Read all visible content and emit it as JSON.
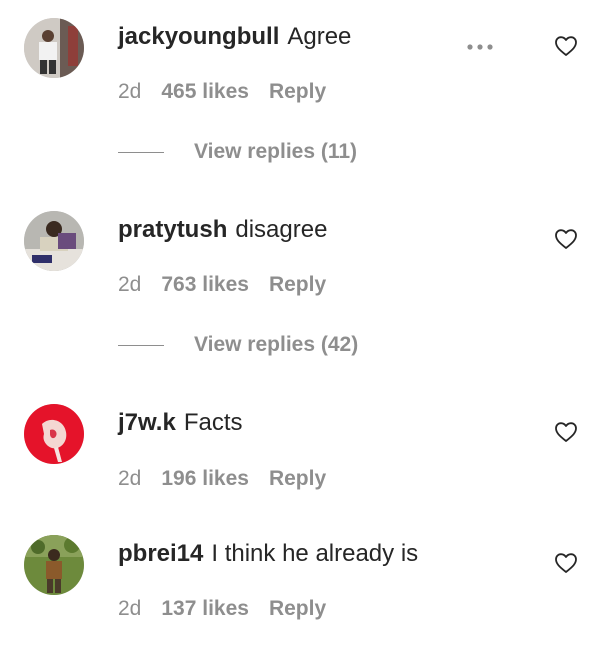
{
  "comments": [
    {
      "username": "jackyoungbull",
      "text": "Agree",
      "age": "2d",
      "likes": "465 likes",
      "reply": "Reply",
      "view_replies": "View replies (11)",
      "avatar_icon": "user-avatar"
    },
    {
      "username": "pratytush",
      "text": "disagree",
      "age": "2d",
      "likes": "763 likes",
      "reply": "Reply",
      "view_replies": "View replies (42)",
      "avatar_icon": "user-avatar"
    },
    {
      "username": "j7w.k",
      "text": "Facts",
      "age": "2d",
      "likes": "196 likes",
      "reply": "Reply",
      "avatar_icon": "user-avatar"
    },
    {
      "username": "pbrei14",
      "text": "I think he already is",
      "age": "2d",
      "likes": "137 likes",
      "reply": "Reply",
      "avatar_icon": "user-avatar"
    }
  ],
  "icons": {
    "like": "heart-outline-icon",
    "more": "more-options-icon"
  },
  "colors": {
    "text": "#262626",
    "secondary": "#8e8e8e",
    "background": "#ffffff"
  }
}
